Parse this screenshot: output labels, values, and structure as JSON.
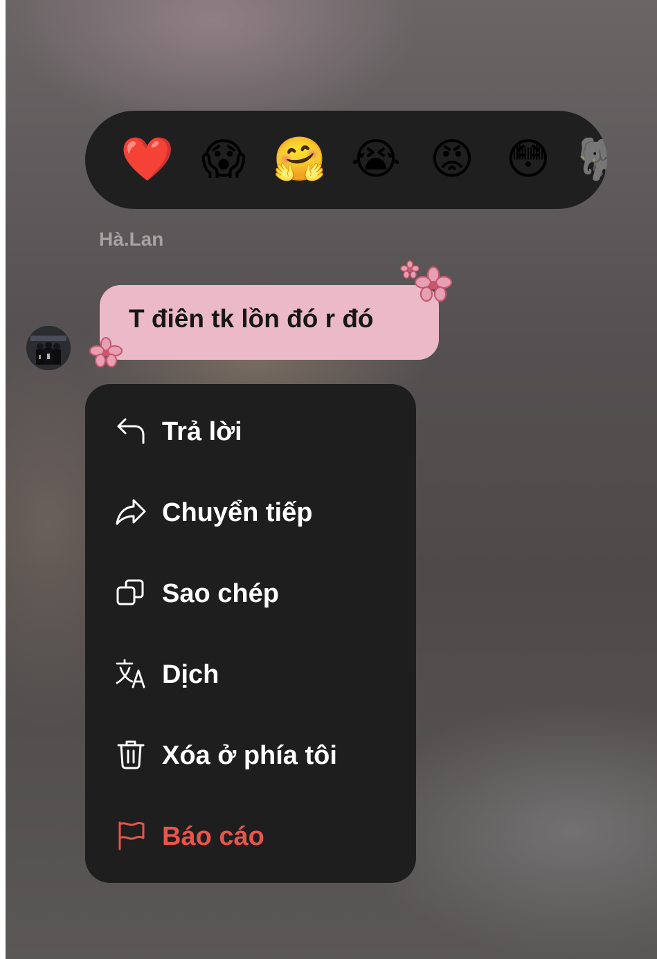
{
  "reactions": [
    {
      "emoji": "❤️",
      "name": "red-heart"
    },
    {
      "emoji": "😱",
      "name": "face-screaming-in-fear"
    },
    {
      "emoji": "🤗",
      "name": "hugging-face"
    },
    {
      "emoji": "😭",
      "name": "loudly-crying-face"
    },
    {
      "emoji": "😡",
      "name": "pouting-face"
    },
    {
      "emoji": "😳",
      "name": "flushed-face"
    },
    {
      "emoji": "🐘",
      "name": "partially-visible-reaction"
    }
  ],
  "message": {
    "sender": "Hà.Lan",
    "text": "T điên tk lồn đó r đó"
  },
  "menu": {
    "items": [
      {
        "label": "Trả lời",
        "icon": "reply-icon"
      },
      {
        "label": "Chuyển tiếp",
        "icon": "forward-icon"
      },
      {
        "label": "Sao chép",
        "icon": "copy-icon"
      },
      {
        "label": "Dịch",
        "icon": "translate-icon"
      },
      {
        "label": "Xóa ở phía tôi",
        "icon": "trash-icon"
      },
      {
        "label": "Báo cáo",
        "icon": "flag-icon"
      }
    ]
  },
  "colors": {
    "menu_background": "#1e1e1e",
    "bubble": "#ecb9c8",
    "danger": "#e8554b",
    "flower": "#c9566d"
  }
}
